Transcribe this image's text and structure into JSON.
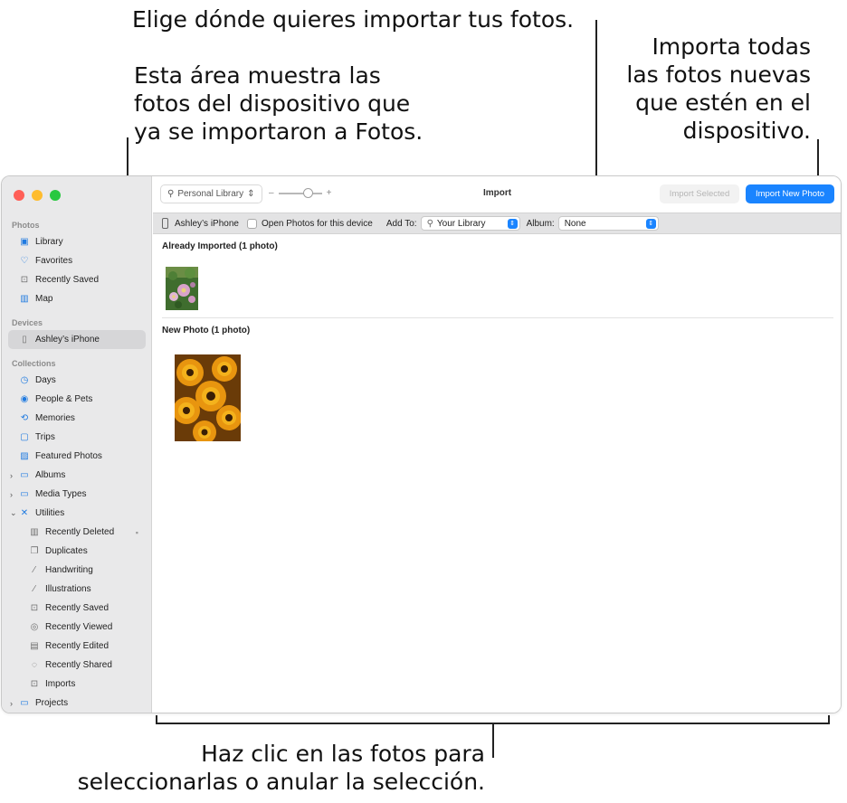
{
  "callouts": {
    "destination": "Elige dónde quieres importar tus fotos.",
    "already_imported": "Esta área muestra las\nfotos del dispositivo que\nya se importaron a Fotos.",
    "import_all": "Importa todas\nlas fotos nuevas\nque estén en el\ndispositivo.",
    "click_photos": "Haz clic en las fotos para\nseleccionarlas o anular la selección."
  },
  "sidebar": {
    "photos_header": "Photos",
    "photos": [
      {
        "label": "Library",
        "icon": "library-icon"
      },
      {
        "label": "Favorites",
        "icon": "heart-icon"
      },
      {
        "label": "Recently Saved",
        "icon": "tray-icon"
      },
      {
        "label": "Map",
        "icon": "map-icon"
      }
    ],
    "devices_header": "Devices",
    "device": "Ashley’s iPhone",
    "collections_header": "Collections",
    "collections": [
      {
        "label": "Days",
        "icon": "clock-icon"
      },
      {
        "label": "People & Pets",
        "icon": "person-circle-icon"
      },
      {
        "label": "Memories",
        "icon": "memories-icon"
      },
      {
        "label": "Trips",
        "icon": "suitcase-icon"
      },
      {
        "label": "Featured Photos",
        "icon": "photo-icon"
      },
      {
        "label": "Albums",
        "icon": "folder-icon"
      },
      {
        "label": "Media Types",
        "icon": "folder-icon"
      },
      {
        "label": "Utilities",
        "icon": "tools-icon"
      }
    ],
    "utilities": [
      {
        "label": "Recently Deleted",
        "icon": "trash-icon"
      },
      {
        "label": "Duplicates",
        "icon": "duplicate-icon"
      },
      {
        "label": "Handwriting",
        "icon": "pen-icon"
      },
      {
        "label": "Illustrations",
        "icon": "brush-icon"
      },
      {
        "label": "Recently Saved",
        "icon": "tray-icon"
      },
      {
        "label": "Recently Viewed",
        "icon": "eye-icon"
      },
      {
        "label": "Recently Edited",
        "icon": "edit-icon"
      },
      {
        "label": "Recently Shared",
        "icon": "share-icon"
      },
      {
        "label": "Imports",
        "icon": "tray-icon"
      }
    ],
    "projects": "Projects"
  },
  "toolbar": {
    "library_selector": "Personal Library",
    "zoom_minus": "–",
    "zoom_plus": "+",
    "title": "Import",
    "import_selected": "Import Selected",
    "import_new": "Import New Photo"
  },
  "import_bar": {
    "device": "Ashley’s iPhone",
    "open_photos_label": "Open Photos for this device",
    "add_to_label": "Add To:",
    "add_to_value": "Your Library",
    "album_label": "Album:",
    "album_value": "None"
  },
  "content": {
    "already_imported_header": "Already Imported (1 photo)",
    "new_photo_header": "New Photo (1 photo)"
  },
  "colors": {
    "accent": "#1a84ff",
    "sidebar_bg": "#e9e9ea"
  }
}
